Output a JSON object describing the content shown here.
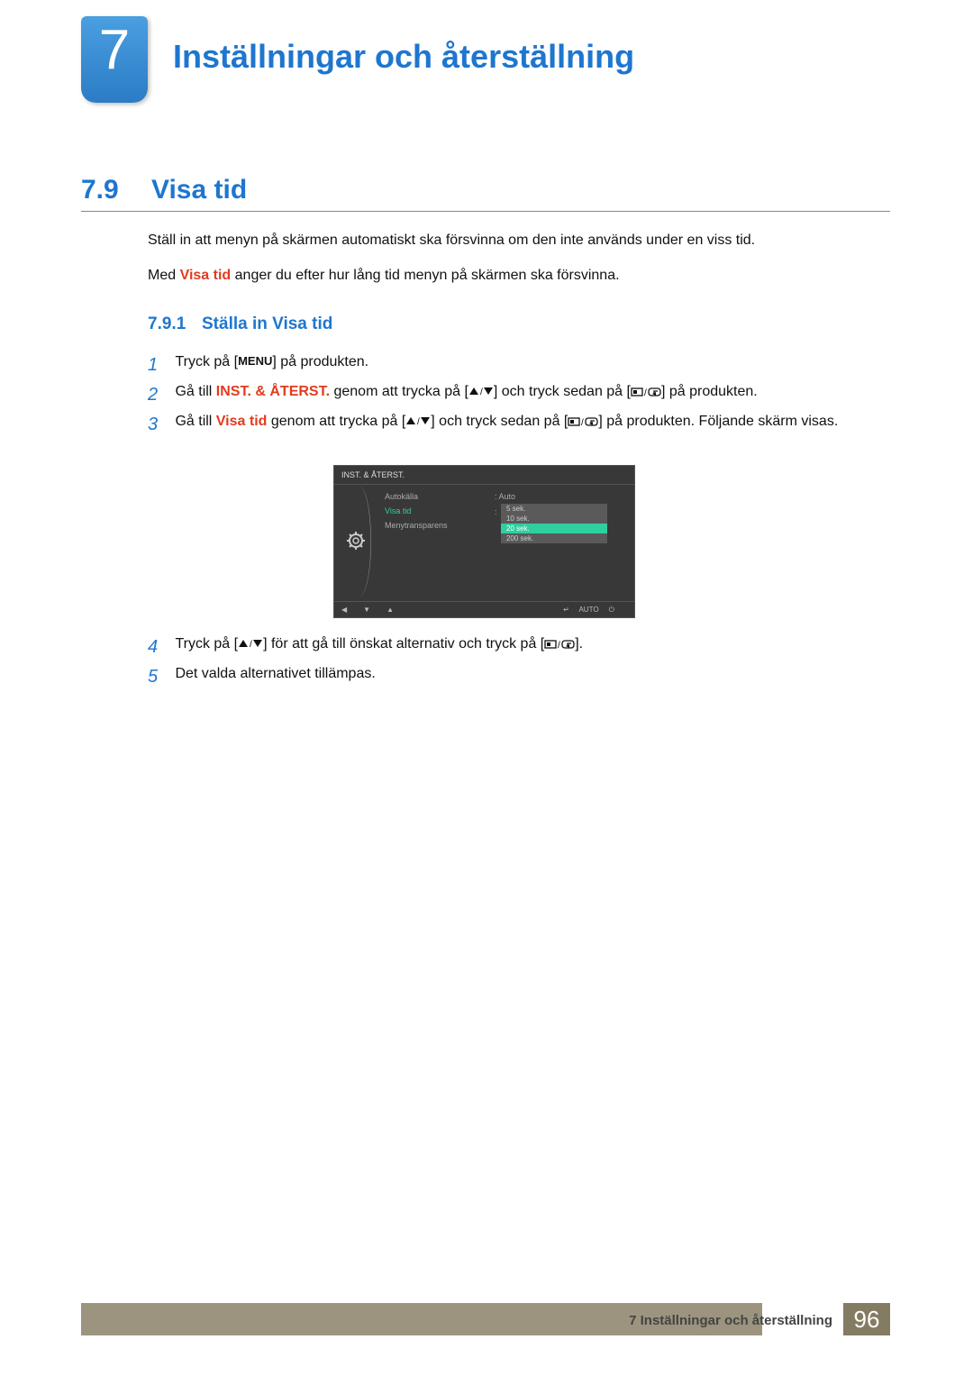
{
  "header": {
    "chapter_number": "7",
    "chapter_title": "Inställningar och återställning"
  },
  "section": {
    "number": "7.9",
    "title": "Visa tid",
    "intro1": "Ställ in att menyn på skärmen automatiskt ska försvinna om den inte används under en viss tid.",
    "intro2_a": "Med ",
    "intro2_hl": "Visa tid",
    "intro2_b": " anger du efter hur lång tid menyn på skärmen ska försvinna."
  },
  "subsection": {
    "number": "7.9.1",
    "title": "Ställa in Visa tid"
  },
  "steps": {
    "s1": {
      "n": "1",
      "a": "Tryck på [",
      "menu": "MENU",
      "b": "] på produkten."
    },
    "s2": {
      "n": "2",
      "a": "Gå till ",
      "hl": "INST. & ÅTERST.",
      "b": " genom att trycka på [",
      "c": "] och tryck sedan på [",
      "d": "] på produkten."
    },
    "s3": {
      "n": "3",
      "a": "Gå till ",
      "hl": "Visa tid",
      "b": " genom att trycka på [",
      "c": "] och tryck sedan på [",
      "d": "] på produkten. Följande skärm visas."
    },
    "s4": {
      "n": "4",
      "a": "Tryck på [",
      "b": "] för att gå till önskat alternativ och tryck på [",
      "c": "]."
    },
    "s5": {
      "n": "5",
      "a": "Det valda alternativet tillämpas."
    }
  },
  "osd": {
    "title": "INST. & ÅTERST.",
    "items": {
      "autokalla": {
        "label": "Autokälla",
        "value": "Auto"
      },
      "visatid": {
        "label": "Visa tid"
      },
      "menytransparens": {
        "label": "Menytransparens"
      }
    },
    "options": [
      "5 sek.",
      "10 sek.",
      "20 sek.",
      "200 sek."
    ],
    "selected_index": 2,
    "footer_auto": "AUTO"
  },
  "footer": {
    "text": "7 Inställningar och återställning",
    "page": "96"
  }
}
